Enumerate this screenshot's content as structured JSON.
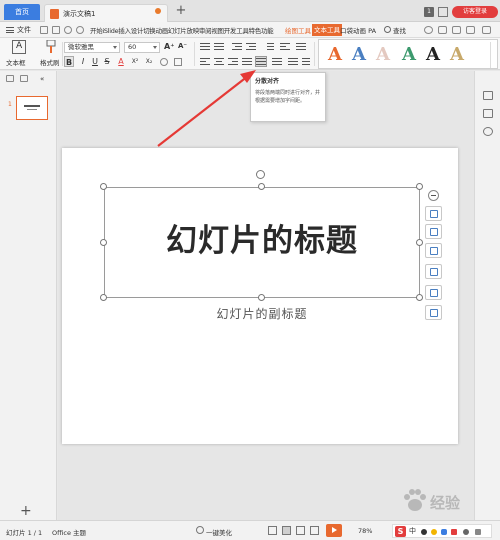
{
  "titlebar": {
    "home_tab": "首页",
    "doc_tab": "演示文稿1",
    "page_count": "1",
    "login": "访客登录"
  },
  "menubar": {
    "file": "文件",
    "items": [
      "开始",
      "iSlide",
      "插入",
      "设计",
      "切换",
      "动画",
      "幻灯片放映",
      "审阅",
      "视图",
      "开发工具",
      "特色功能"
    ],
    "drawing_tools": "绘图工具",
    "text_tools": "文本工具",
    "after": [
      "口袋动画",
      "PA"
    ],
    "search": "查找"
  },
  "ribbon": {
    "textbox_label": "文本框",
    "format_brush_label": "格式刷",
    "font_name": "微软雅黑",
    "font_size": "60",
    "grow_font": "A⁺",
    "shrink_font": "A⁻",
    "format_buttons": [
      "B",
      "I",
      "U",
      "S",
      "A",
      "X²",
      "X₂"
    ],
    "style_letters": [
      "A",
      "A",
      "A",
      "A",
      "A",
      "A"
    ],
    "style_colors": [
      "#e8692f",
      "#4a7fc1",
      "#e4c9c0",
      "#3d9a6e",
      "#222222",
      "#c8a96a"
    ]
  },
  "tooltip": {
    "title": "分散对齐",
    "body": "将段落两端同时进行对齐，并根据需要增加字间距。"
  },
  "slides_panel": {
    "slide_number": "1"
  },
  "slide": {
    "title": "幻灯片的标题",
    "subtitle": "幻灯片的副标题"
  },
  "statusbar": {
    "slide_info": "幻灯片 1 / 1",
    "theme": "Office 主题",
    "beautify": "一键美化",
    "zoom": "78%"
  },
  "ime": {
    "logo": "S",
    "mode": "中"
  },
  "watermark": {
    "text": "经验"
  },
  "colors": {
    "accent_orange": "#e8692f",
    "home_blue": "#3b7de0",
    "login_red": "#e23d3d",
    "arrow_red": "#e53935"
  }
}
